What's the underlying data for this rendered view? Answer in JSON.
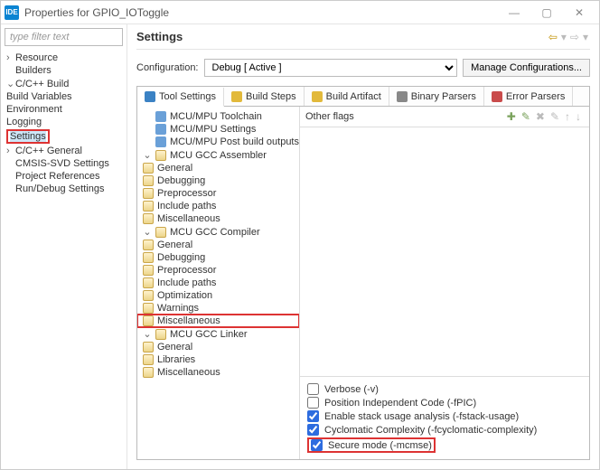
{
  "window": {
    "app_badge": "IDE",
    "title": "Properties for GPIO_IOToggle"
  },
  "filter_placeholder": "type filter text",
  "left_tree": {
    "resource": "Resource",
    "builders": "Builders",
    "cpp_build": "C/C++ Build",
    "build_variables": "Build Variables",
    "environment": "Environment",
    "logging": "Logging",
    "settings": "Settings",
    "cpp_general": "C/C++ General",
    "cmsis": "CMSIS-SVD Settings",
    "proj_refs": "Project References",
    "run_debug": "Run/Debug Settings"
  },
  "heading": "Settings",
  "config_label": "Configuration:",
  "config_value": "Debug  [ Active ]",
  "manage_btn": "Manage Configurations...",
  "tabs": {
    "tool": "Tool Settings",
    "steps": "Build Steps",
    "artifact": "Build Artifact",
    "binary": "Binary Parsers",
    "error": "Error Parsers"
  },
  "tool_tree": {
    "toolchain": "MCU/MPU Toolchain",
    "mpu_settings": "MCU/MPU Settings",
    "post_build": "MCU/MPU Post build outputs",
    "assembler": "MCU GCC Assembler",
    "compiler": "MCU GCC Compiler",
    "linker": "MCU GCC Linker",
    "general": "General",
    "debugging": "Debugging",
    "preprocessor": "Preprocessor",
    "include": "Include paths",
    "misc": "Miscellaneous",
    "optimization": "Optimization",
    "warnings": "Warnings",
    "libraries": "Libraries"
  },
  "other_flags_label": "Other flags",
  "checks": {
    "verbose": {
      "label": "Verbose (-v)",
      "checked": false
    },
    "pic": {
      "label": "Position Independent Code (-fPIC)",
      "checked": false
    },
    "stack": {
      "label": "Enable stack usage analysis (-fstack-usage)",
      "checked": true
    },
    "cyclo": {
      "label": "Cyclomatic Complexity (-fcyclomatic-complexity)",
      "checked": true
    },
    "secure": {
      "label": "Secure mode (-mcmse)",
      "checked": true
    }
  }
}
